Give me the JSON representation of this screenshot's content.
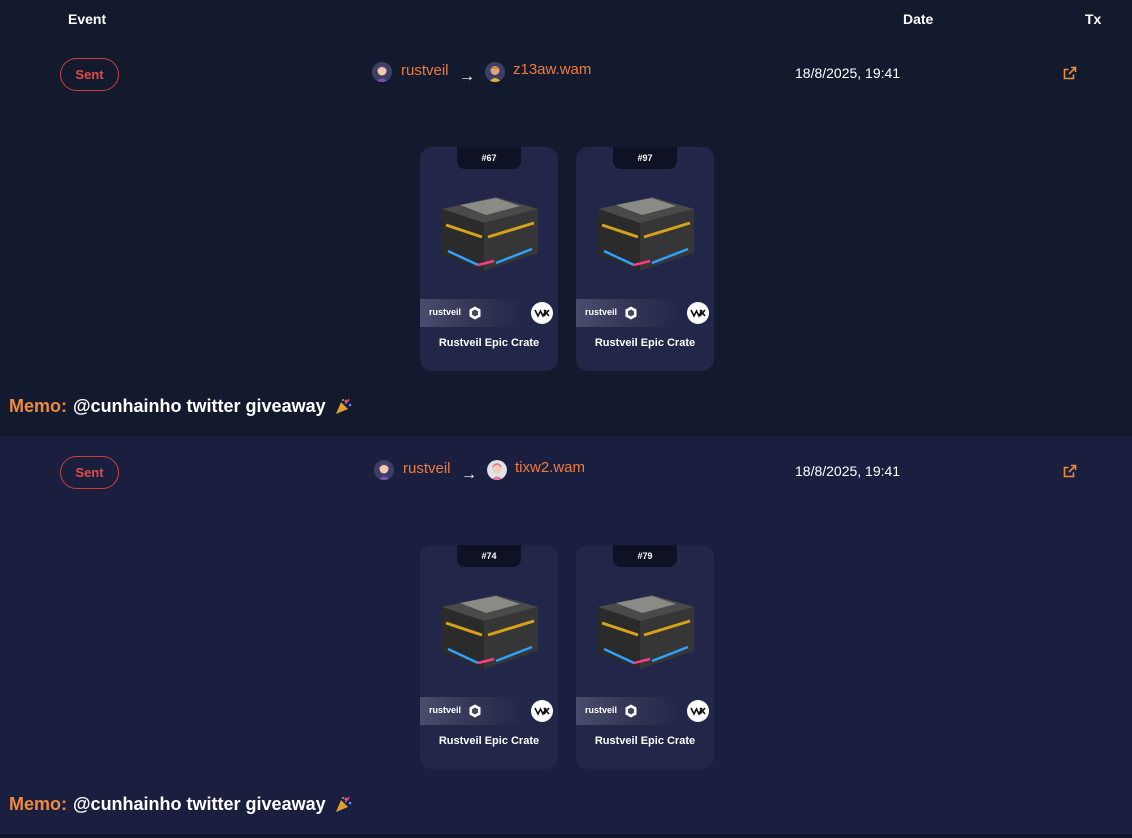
{
  "header": {
    "event": "Event",
    "date": "Date",
    "tx": "Tx"
  },
  "colors": {
    "accent": "#ee7a3e",
    "memo_label": "#ef8a3c",
    "sent_badge": "#e24a45",
    "row_alt": "#1b1f3f",
    "background": "#141a2e",
    "card": "#222648"
  },
  "events": [
    {
      "type": "Sent",
      "from": "rustveil",
      "to": "z13aw.wam",
      "date": "18/8/2025, 19:41",
      "tx_icon": "external-link-icon",
      "assets": [
        {
          "mint": "#67",
          "collection": "rustveil",
          "name": "Rustveil Epic Crate"
        },
        {
          "mint": "#97",
          "collection": "rustveil",
          "name": "Rustveil Epic Crate"
        }
      ],
      "memo_label": "Memo:",
      "memo": "@cunhainho twitter giveaway"
    },
    {
      "type": "Sent",
      "from": "rustveil",
      "to": "tixw2.wam",
      "date": "18/8/2025, 19:41",
      "tx_icon": "external-link-icon",
      "assets": [
        {
          "mint": "#74",
          "collection": "rustveil",
          "name": "Rustveil Epic Crate"
        },
        {
          "mint": "#79",
          "collection": "rustveil",
          "name": "Rustveil Epic Crate"
        }
      ],
      "memo_label": "Memo:",
      "memo": "@cunhainho twitter giveaway"
    }
  ]
}
